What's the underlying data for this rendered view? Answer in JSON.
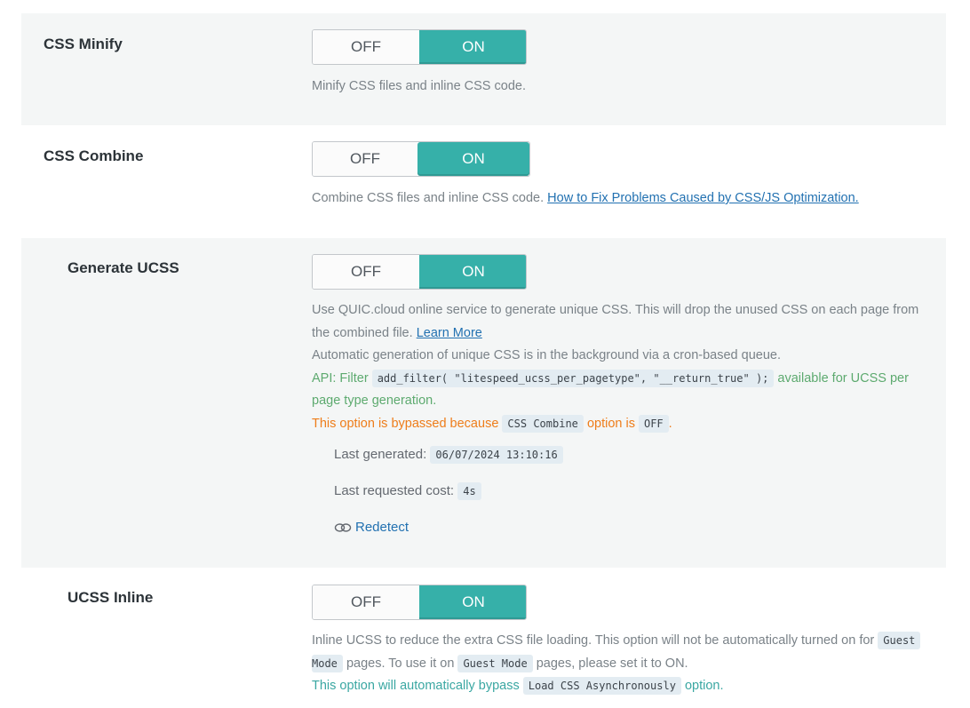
{
  "rows": [
    {
      "label": "CSS Minify",
      "toggle": {
        "off": "OFF",
        "on": "ON",
        "state": "ON"
      },
      "description": "Minify CSS files and inline CSS code."
    },
    {
      "label": "CSS Combine",
      "toggle": {
        "off": "OFF",
        "on": "ON",
        "state": "ON"
      },
      "description": "Combine CSS files and inline CSS code.",
      "link": "How to Fix Problems Caused by CSS/JS Optimization."
    },
    {
      "label": "Generate UCSS",
      "toggle": {
        "off": "OFF",
        "on": "ON",
        "state": "ON"
      },
      "desc_line1": "Use QUIC.cloud online service to generate unique CSS. This will drop the unused CSS on each page from",
      "desc_line2": "the combined file.",
      "learn_more": "Learn More",
      "desc_line3": "Automatic generation of unique CSS is in the background via a cron-based queue.",
      "api_prefix": "API: Filter",
      "api_code": "add_filter( \"litespeed_ucss_per_pagetype\", \"__return_true\" );",
      "api_suffix": "available for UCSS per",
      "api_suffix2": "page type generation.",
      "bypass_prefix": "This option is bypassed because",
      "bypass_code1": "CSS Combine",
      "bypass_mid": "option is",
      "bypass_code2": "OFF",
      "bypass_end": ".",
      "last_generated_label": "Last generated:",
      "last_generated_value": "06/07/2024 13:10:16",
      "last_cost_label": "Last requested cost:",
      "last_cost_value": "4s",
      "redetect": "Redetect"
    },
    {
      "label": "UCSS Inline",
      "toggle": {
        "off": "OFF",
        "on": "ON",
        "state": "ON"
      },
      "desc_part1": "Inline UCSS to reduce the extra CSS file loading. This option will not be automatically turned on for",
      "code_guest": "Guest",
      "code_mode": "Mode",
      "desc_part2": "pages. To use it on",
      "code_guest_mode": "Guest Mode",
      "desc_part3": "pages, please set it to ON.",
      "bypass_prefix": "This option will automatically bypass",
      "bypass_code": "Load CSS Asynchronously",
      "bypass_suffix": "option."
    }
  ],
  "colors": {
    "accent": "#36b0a9",
    "link": "#2271b1",
    "warning": "#ee7d1a",
    "api": "#5daa6f"
  }
}
